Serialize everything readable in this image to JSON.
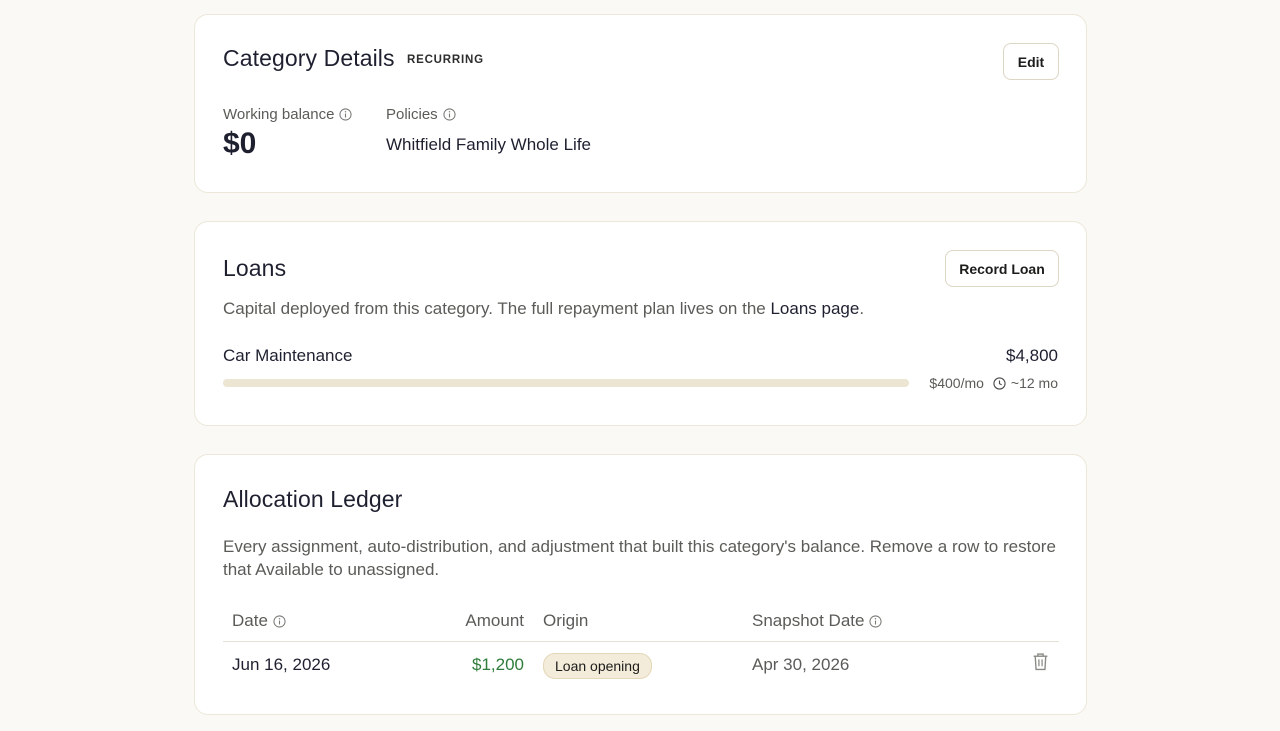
{
  "details": {
    "title": "Category Details",
    "badge": "RECURRING",
    "edit_label": "Edit",
    "working_balance_label": "Working balance",
    "working_balance_value": "$0",
    "policies_label": "Policies",
    "policies_value": "Whitfield Family Whole Life"
  },
  "loans": {
    "title": "Loans",
    "record_label": "Record Loan",
    "description_prefix": "Capital deployed from this category. The full repayment plan lives on the ",
    "description_link": "Loans page",
    "description_suffix": ".",
    "items": [
      {
        "name": "Car Maintenance",
        "amount": "$4,800",
        "monthly": "$400/mo",
        "duration": "~12 mo",
        "progress_fraction": 0
      }
    ]
  },
  "ledger": {
    "title": "Allocation Ledger",
    "description": "Every assignment, auto-distribution, and adjustment that built this category's balance. Remove a row to restore that Available to unassigned.",
    "columns": {
      "date": "Date",
      "amount": "Amount",
      "origin": "Origin",
      "snapshot_date": "Snapshot Date"
    },
    "rows": [
      {
        "date": "Jun 16, 2026",
        "amount": "$1,200",
        "origin": "Loan opening",
        "snapshot_date": "Apr 30, 2026"
      }
    ]
  },
  "icons": {
    "info": "info-icon",
    "clock": "clock-icon",
    "trash": "trash-icon"
  },
  "colors": {
    "background": "#faf9f5",
    "card_border": "#ece7d8",
    "positive_amount": "#2f7d3a",
    "pill_bg": "#f4ecda",
    "progress_track": "#ece5d2"
  }
}
